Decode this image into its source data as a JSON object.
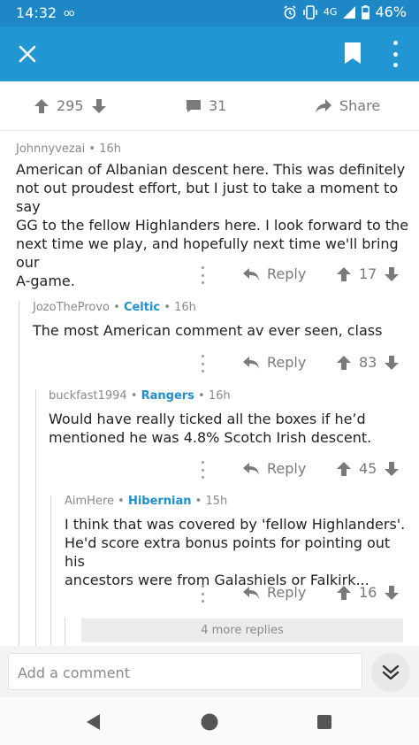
{
  "status_bar": {
    "time": "14:32",
    "voicemail": "oo",
    "network": "4G",
    "battery": "46%"
  },
  "post_bar": {
    "score": "295",
    "comments": "31",
    "share_label": "Share"
  },
  "comments": [
    {
      "author": "Johnnyvezai",
      "flair": "",
      "age": "16h",
      "body_lines": [
        "American of Albanian descent here. This was definitely",
        "not out proudest effort, but I just to take a moment to say",
        "GG to the fellow Highlanders here. I look forward to the",
        "next time we play, and hopefully next time we'll bring our",
        "A-game."
      ],
      "reply_label": "Reply",
      "score": "17"
    },
    {
      "author": "JozoTheProvo",
      "flair": "Celtic",
      "age": "16h",
      "body_lines": [
        "The most American comment av ever seen, class"
      ],
      "reply_label": "Reply",
      "score": "83"
    },
    {
      "author": "buckfast1994",
      "flair": "Rangers",
      "age": "16h",
      "body_lines": [
        "Would have really ticked all the boxes if he’d",
        "mentioned he was 4.8% Scotch Irish descent."
      ],
      "reply_label": "Reply",
      "score": "45"
    },
    {
      "author": "AimHere",
      "flair": "Hibernian",
      "age": "15h",
      "body_lines": [
        "I think that was covered by 'fellow Highlanders'.",
        "He'd score extra bonus points for pointing out his",
        "ancestors were from Galashiels or Falkirk..."
      ],
      "reply_label": "Reply",
      "score": "16"
    }
  ],
  "more_replies": "4 more replies",
  "composer": {
    "placeholder": "Add a comment"
  },
  "colors": {
    "primary": "#2196d3",
    "status_bar": "#1e88c7",
    "flair": "#1e8fd0"
  },
  "icons": {
    "close": "close-icon",
    "bookmark": "bookmark-icon",
    "more": "overflow-menu-icon",
    "upvote": "arrow-up-icon",
    "downvote": "arrow-down-icon",
    "comment": "comment-icon",
    "share": "share-icon",
    "reply": "reply-icon",
    "expand": "double-chevron-down-icon"
  }
}
